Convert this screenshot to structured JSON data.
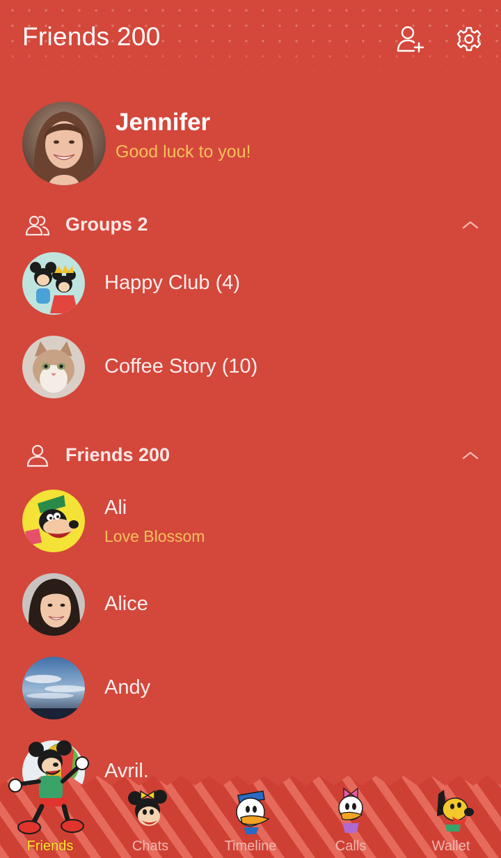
{
  "header": {
    "title": "Friends 200",
    "add_friend_icon": "add-person-icon",
    "settings_icon": "gear-icon"
  },
  "profile": {
    "name": "Jennifer",
    "status": "Good luck to you!"
  },
  "groups_section": {
    "label": "Groups 2",
    "icon": "group-icon",
    "expanded": true,
    "items": [
      {
        "name": "Happy Club (4)"
      },
      {
        "name": "Coffee Story (10)"
      }
    ]
  },
  "friends_section": {
    "label": "Friends 200",
    "icon": "person-icon",
    "expanded": true,
    "items": [
      {
        "name": "Ali",
        "status": "Love Blossom"
      },
      {
        "name": "Alice"
      },
      {
        "name": "Andy"
      },
      {
        "name": "Avril."
      }
    ]
  },
  "tabs": [
    {
      "label": "Friends",
      "active": true
    },
    {
      "label": "Chats",
      "active": false
    },
    {
      "label": "Timeline",
      "active": false
    },
    {
      "label": "Calls",
      "active": false
    },
    {
      "label": "Wallet",
      "active": false
    }
  ],
  "colors": {
    "background": "#d4473b",
    "accent_status": "#f6c15a",
    "active_tab": "#ffe82e"
  }
}
